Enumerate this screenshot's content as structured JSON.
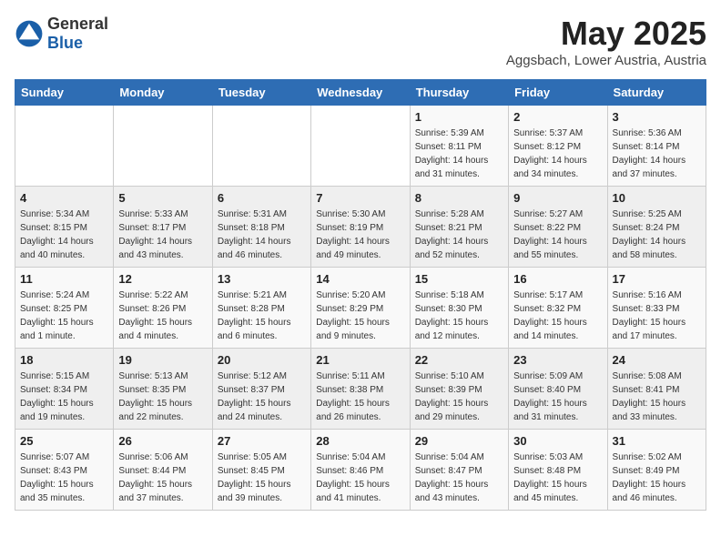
{
  "header": {
    "logo_general": "General",
    "logo_blue": "Blue",
    "month_year": "May 2025",
    "location": "Aggsbach, Lower Austria, Austria"
  },
  "days_of_week": [
    "Sunday",
    "Monday",
    "Tuesday",
    "Wednesday",
    "Thursday",
    "Friday",
    "Saturday"
  ],
  "weeks": [
    [
      {
        "day": "",
        "info": ""
      },
      {
        "day": "",
        "info": ""
      },
      {
        "day": "",
        "info": ""
      },
      {
        "day": "",
        "info": ""
      },
      {
        "day": "1",
        "info": "Sunrise: 5:39 AM\nSunset: 8:11 PM\nDaylight: 14 hours\nand 31 minutes."
      },
      {
        "day": "2",
        "info": "Sunrise: 5:37 AM\nSunset: 8:12 PM\nDaylight: 14 hours\nand 34 minutes."
      },
      {
        "day": "3",
        "info": "Sunrise: 5:36 AM\nSunset: 8:14 PM\nDaylight: 14 hours\nand 37 minutes."
      }
    ],
    [
      {
        "day": "4",
        "info": "Sunrise: 5:34 AM\nSunset: 8:15 PM\nDaylight: 14 hours\nand 40 minutes."
      },
      {
        "day": "5",
        "info": "Sunrise: 5:33 AM\nSunset: 8:17 PM\nDaylight: 14 hours\nand 43 minutes."
      },
      {
        "day": "6",
        "info": "Sunrise: 5:31 AM\nSunset: 8:18 PM\nDaylight: 14 hours\nand 46 minutes."
      },
      {
        "day": "7",
        "info": "Sunrise: 5:30 AM\nSunset: 8:19 PM\nDaylight: 14 hours\nand 49 minutes."
      },
      {
        "day": "8",
        "info": "Sunrise: 5:28 AM\nSunset: 8:21 PM\nDaylight: 14 hours\nand 52 minutes."
      },
      {
        "day": "9",
        "info": "Sunrise: 5:27 AM\nSunset: 8:22 PM\nDaylight: 14 hours\nand 55 minutes."
      },
      {
        "day": "10",
        "info": "Sunrise: 5:25 AM\nSunset: 8:24 PM\nDaylight: 14 hours\nand 58 minutes."
      }
    ],
    [
      {
        "day": "11",
        "info": "Sunrise: 5:24 AM\nSunset: 8:25 PM\nDaylight: 15 hours\nand 1 minute."
      },
      {
        "day": "12",
        "info": "Sunrise: 5:22 AM\nSunset: 8:26 PM\nDaylight: 15 hours\nand 4 minutes."
      },
      {
        "day": "13",
        "info": "Sunrise: 5:21 AM\nSunset: 8:28 PM\nDaylight: 15 hours\nand 6 minutes."
      },
      {
        "day": "14",
        "info": "Sunrise: 5:20 AM\nSunset: 8:29 PM\nDaylight: 15 hours\nand 9 minutes."
      },
      {
        "day": "15",
        "info": "Sunrise: 5:18 AM\nSunset: 8:30 PM\nDaylight: 15 hours\nand 12 minutes."
      },
      {
        "day": "16",
        "info": "Sunrise: 5:17 AM\nSunset: 8:32 PM\nDaylight: 15 hours\nand 14 minutes."
      },
      {
        "day": "17",
        "info": "Sunrise: 5:16 AM\nSunset: 8:33 PM\nDaylight: 15 hours\nand 17 minutes."
      }
    ],
    [
      {
        "day": "18",
        "info": "Sunrise: 5:15 AM\nSunset: 8:34 PM\nDaylight: 15 hours\nand 19 minutes."
      },
      {
        "day": "19",
        "info": "Sunrise: 5:13 AM\nSunset: 8:35 PM\nDaylight: 15 hours\nand 22 minutes."
      },
      {
        "day": "20",
        "info": "Sunrise: 5:12 AM\nSunset: 8:37 PM\nDaylight: 15 hours\nand 24 minutes."
      },
      {
        "day": "21",
        "info": "Sunrise: 5:11 AM\nSunset: 8:38 PM\nDaylight: 15 hours\nand 26 minutes."
      },
      {
        "day": "22",
        "info": "Sunrise: 5:10 AM\nSunset: 8:39 PM\nDaylight: 15 hours\nand 29 minutes."
      },
      {
        "day": "23",
        "info": "Sunrise: 5:09 AM\nSunset: 8:40 PM\nDaylight: 15 hours\nand 31 minutes."
      },
      {
        "day": "24",
        "info": "Sunrise: 5:08 AM\nSunset: 8:41 PM\nDaylight: 15 hours\nand 33 minutes."
      }
    ],
    [
      {
        "day": "25",
        "info": "Sunrise: 5:07 AM\nSunset: 8:43 PM\nDaylight: 15 hours\nand 35 minutes."
      },
      {
        "day": "26",
        "info": "Sunrise: 5:06 AM\nSunset: 8:44 PM\nDaylight: 15 hours\nand 37 minutes."
      },
      {
        "day": "27",
        "info": "Sunrise: 5:05 AM\nSunset: 8:45 PM\nDaylight: 15 hours\nand 39 minutes."
      },
      {
        "day": "28",
        "info": "Sunrise: 5:04 AM\nSunset: 8:46 PM\nDaylight: 15 hours\nand 41 minutes."
      },
      {
        "day": "29",
        "info": "Sunrise: 5:04 AM\nSunset: 8:47 PM\nDaylight: 15 hours\nand 43 minutes."
      },
      {
        "day": "30",
        "info": "Sunrise: 5:03 AM\nSunset: 8:48 PM\nDaylight: 15 hours\nand 45 minutes."
      },
      {
        "day": "31",
        "info": "Sunrise: 5:02 AM\nSunset: 8:49 PM\nDaylight: 15 hours\nand 46 minutes."
      }
    ]
  ]
}
